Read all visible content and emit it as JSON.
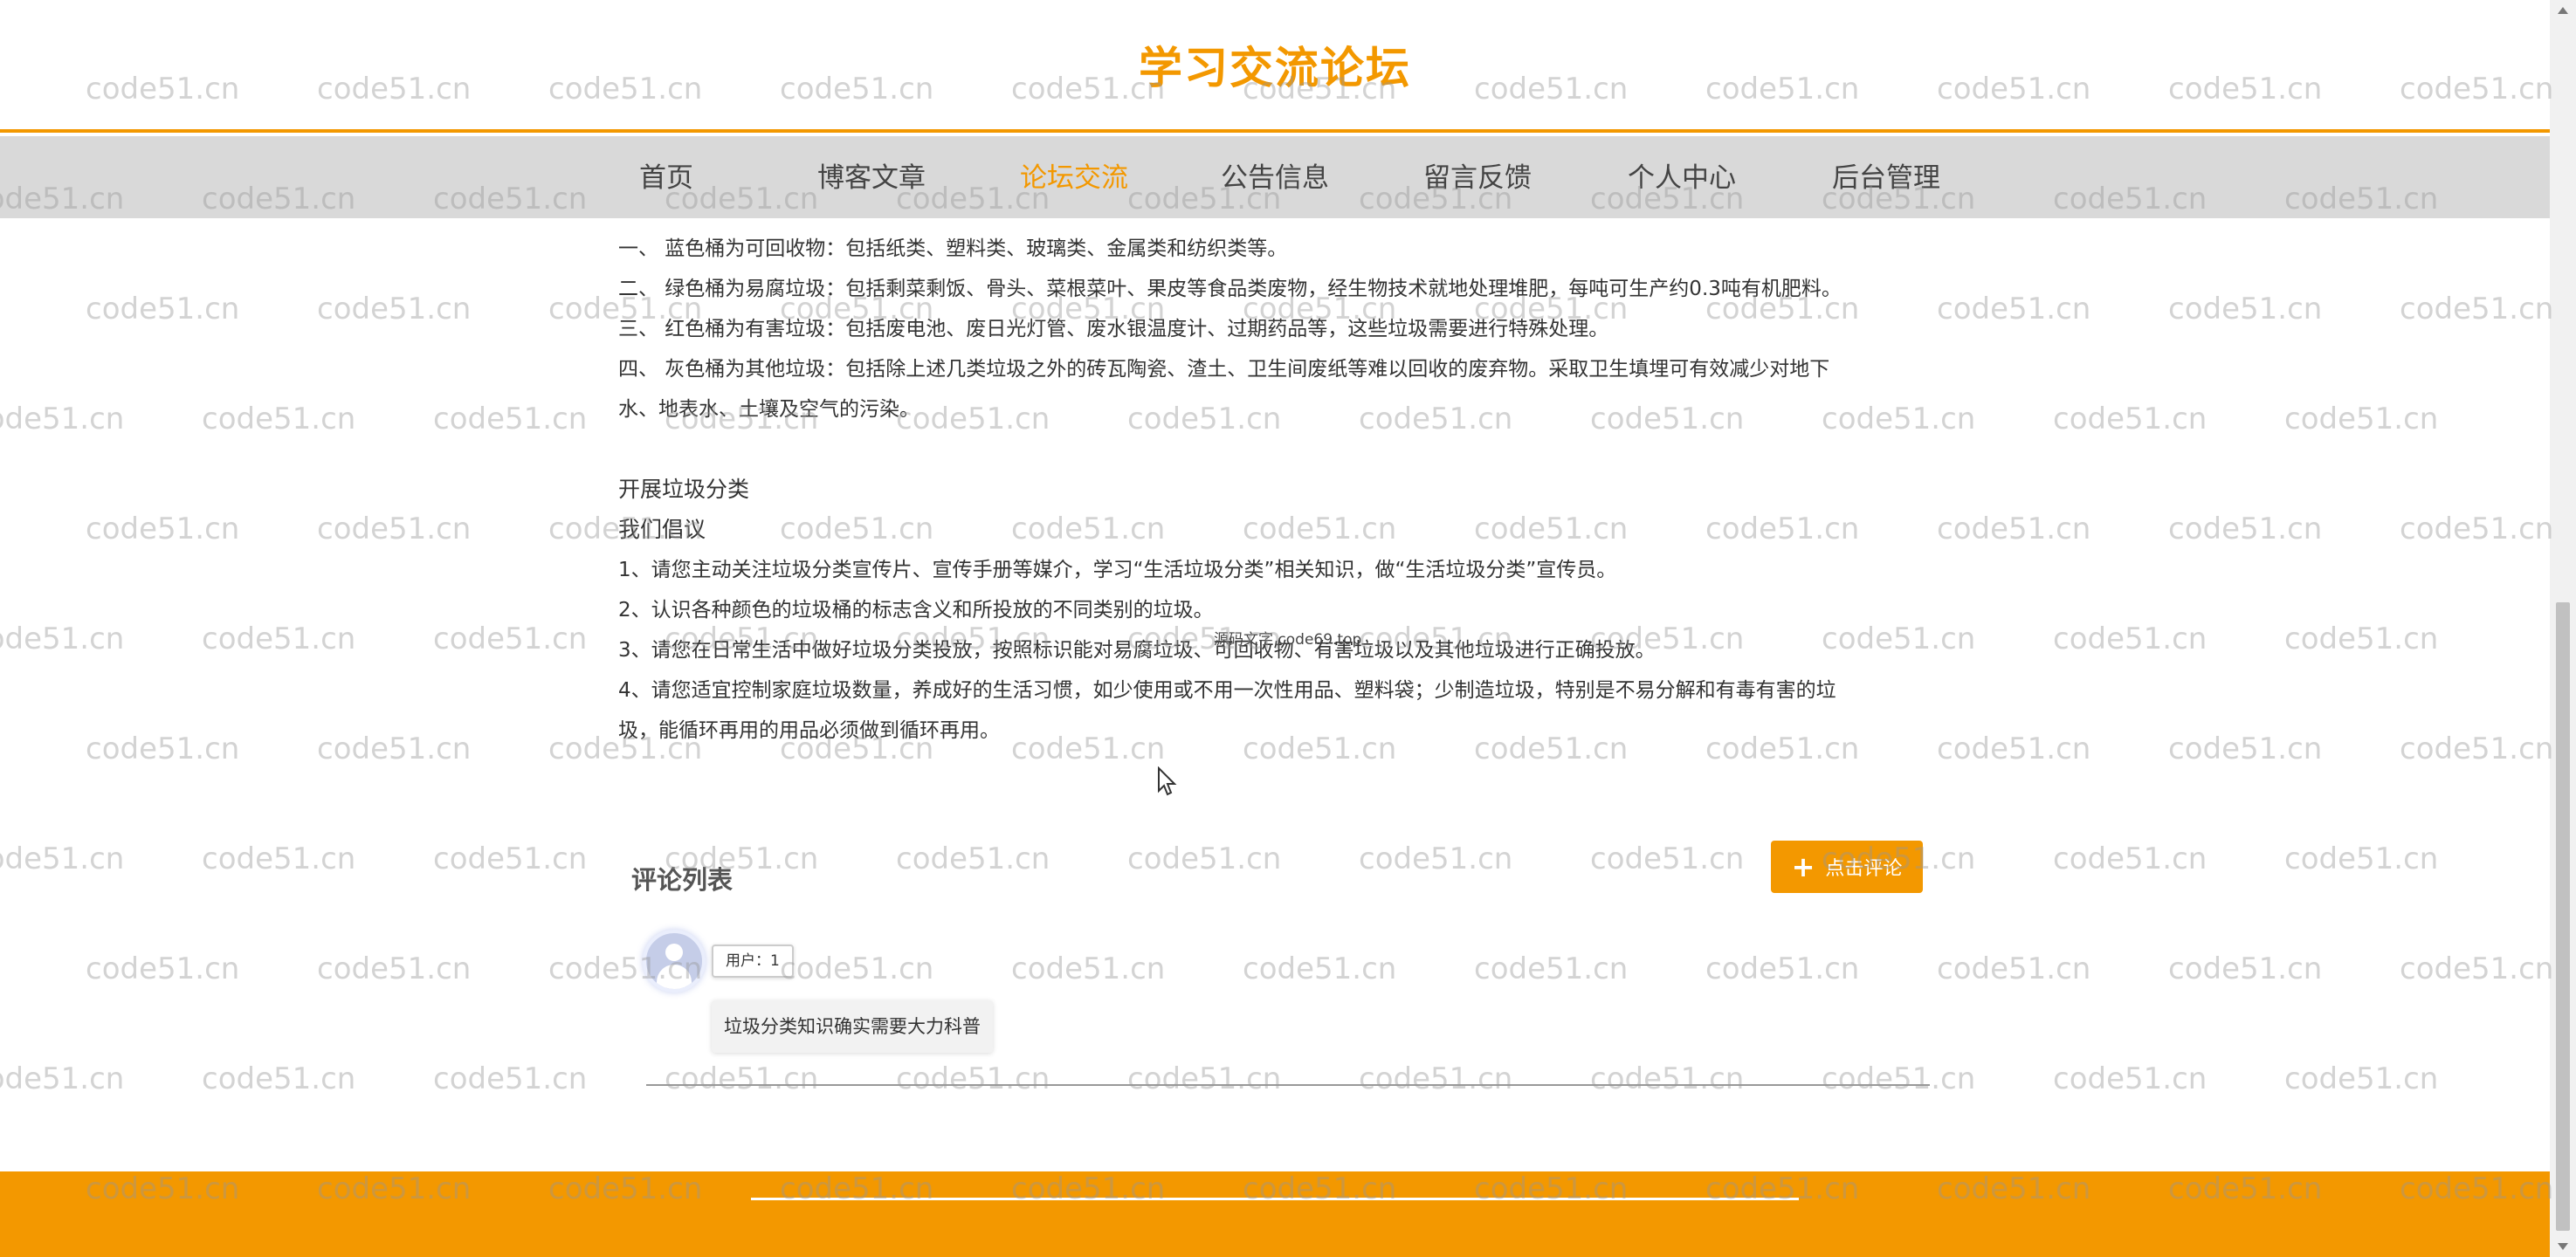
{
  "site": {
    "title": "学习交流论坛"
  },
  "nav": {
    "items": [
      {
        "label": "首页",
        "active": false
      },
      {
        "label": "博客文章",
        "active": false
      },
      {
        "label": "论坛交流",
        "active": true
      },
      {
        "label": "公告信息",
        "active": false
      },
      {
        "label": "留言反馈",
        "active": false
      },
      {
        "label": "个人中心",
        "active": false
      },
      {
        "label": "后台管理",
        "active": false
      }
    ]
  },
  "article": {
    "bins": [
      "一、 蓝色桶为可回收物：包括纸类、塑料类、玻璃类、金属类和纺织类等。",
      "二、 绿色桶为易腐垃圾：包括剩菜剩饭、骨头、菜根菜叶、果皮等食品类废物，经生物技术就地处理堆肥，每吨可生产约0.3吨有机肥料。",
      "三、 红色桶为有害垃圾：包括废电池、废日光灯管、废水银温度计、过期药品等，这些垃圾需要进行特殊处理。",
      "四、 灰色桶为其他垃圾：包括除上述几类垃圾之外的砖瓦陶瓷、渣土、卫生间废纸等难以回收的废弃物。采取卫生填埋可有效减少对地下",
      "水、地表水、土壤及空气的污染。"
    ],
    "subheading": "开展垃圾分类",
    "proposal_heading": "我们倡议",
    "proposals": [
      "1、请您主动关注垃圾分类宣传片、宣传手册等媒介，学习“生活垃圾分类”相关知识，做“生活垃圾分类”宣传员。",
      "2、认识各种颜色的垃圾桶的标志含义和所投放的不同类别的垃圾。",
      "3、请您在日常生活中做好垃圾分类投放，按照标识能对易腐垃圾、可回收物、有害垃圾以及其他垃圾进行正确投放。",
      "4、请您适宜控制家庭垃圾数量，养成好的生活习惯，如少使用或不用一次性用品、塑料袋；少制造垃圾，特别是不易分解和有毒有害的垃",
      "圾，能循环再用的用品必须做到循环再用。"
    ]
  },
  "overlay_note": "源码文字 code69.top",
  "comments": {
    "title": "评论列表",
    "add_label": "点击评论",
    "items": [
      {
        "user": "用户：1",
        "text": "垃圾分类知识确实需要大力科普"
      }
    ]
  },
  "watermark": {
    "text": "code51.cn"
  },
  "colors": {
    "accent": "#f39800",
    "nav_bg": "#d9d9d9"
  }
}
